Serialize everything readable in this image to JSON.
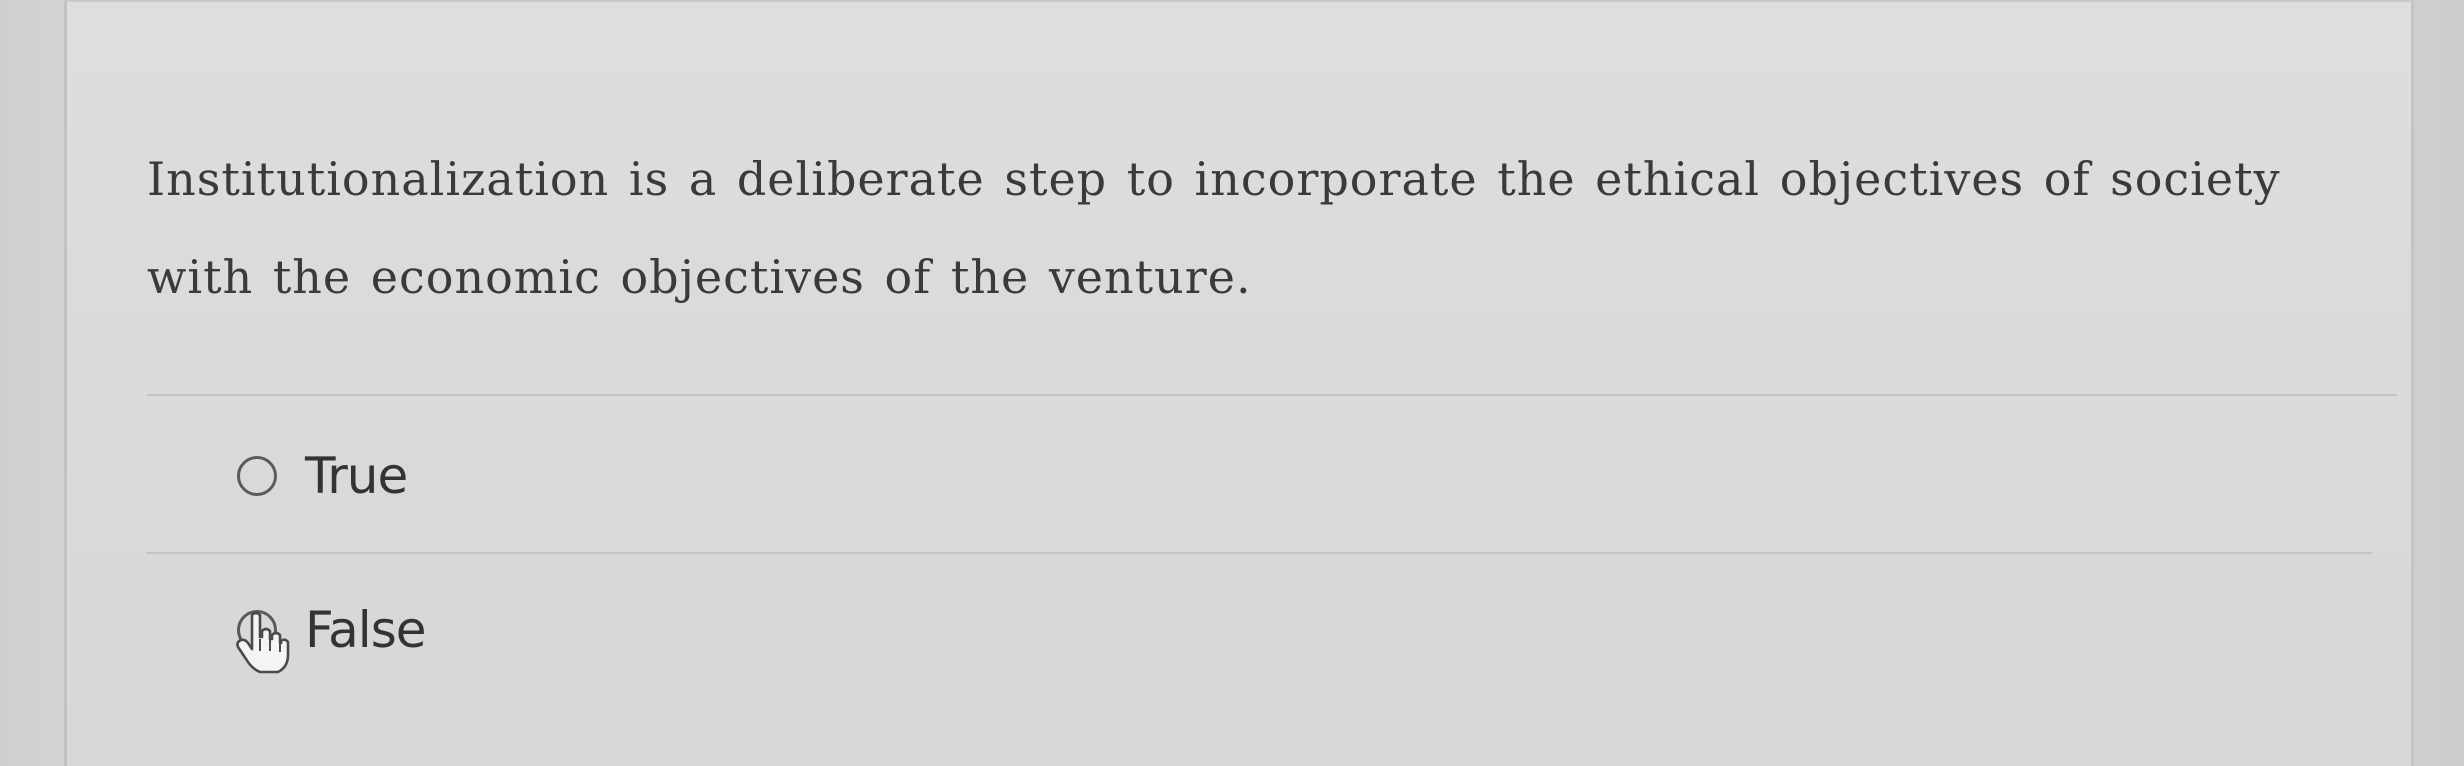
{
  "question": {
    "text": "Institutionalization is a deliberate step to incorporate the ethical objectives of society with the economic objectives of the venture."
  },
  "options": [
    {
      "label": "True",
      "selected": false
    },
    {
      "label": "False",
      "selected": false
    }
  ],
  "cursor": {
    "icon": "hand-pointer-icon"
  }
}
